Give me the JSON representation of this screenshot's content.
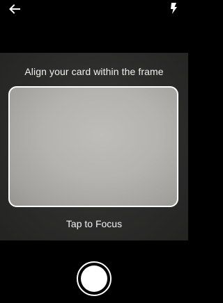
{
  "header": {
    "back_icon": "arrow-left-icon",
    "flash_icon": "flash-icon"
  },
  "viewfinder": {
    "instruction": "Align your card within the frame",
    "focus_hint": "Tap to Focus"
  },
  "controls": {
    "shutter_icon": "shutter-circle-icon"
  },
  "colors": {
    "background": "#000000",
    "viewfinder": "#2c2c2b",
    "frame_border": "#ffffff",
    "text": "#f2f2f2"
  }
}
